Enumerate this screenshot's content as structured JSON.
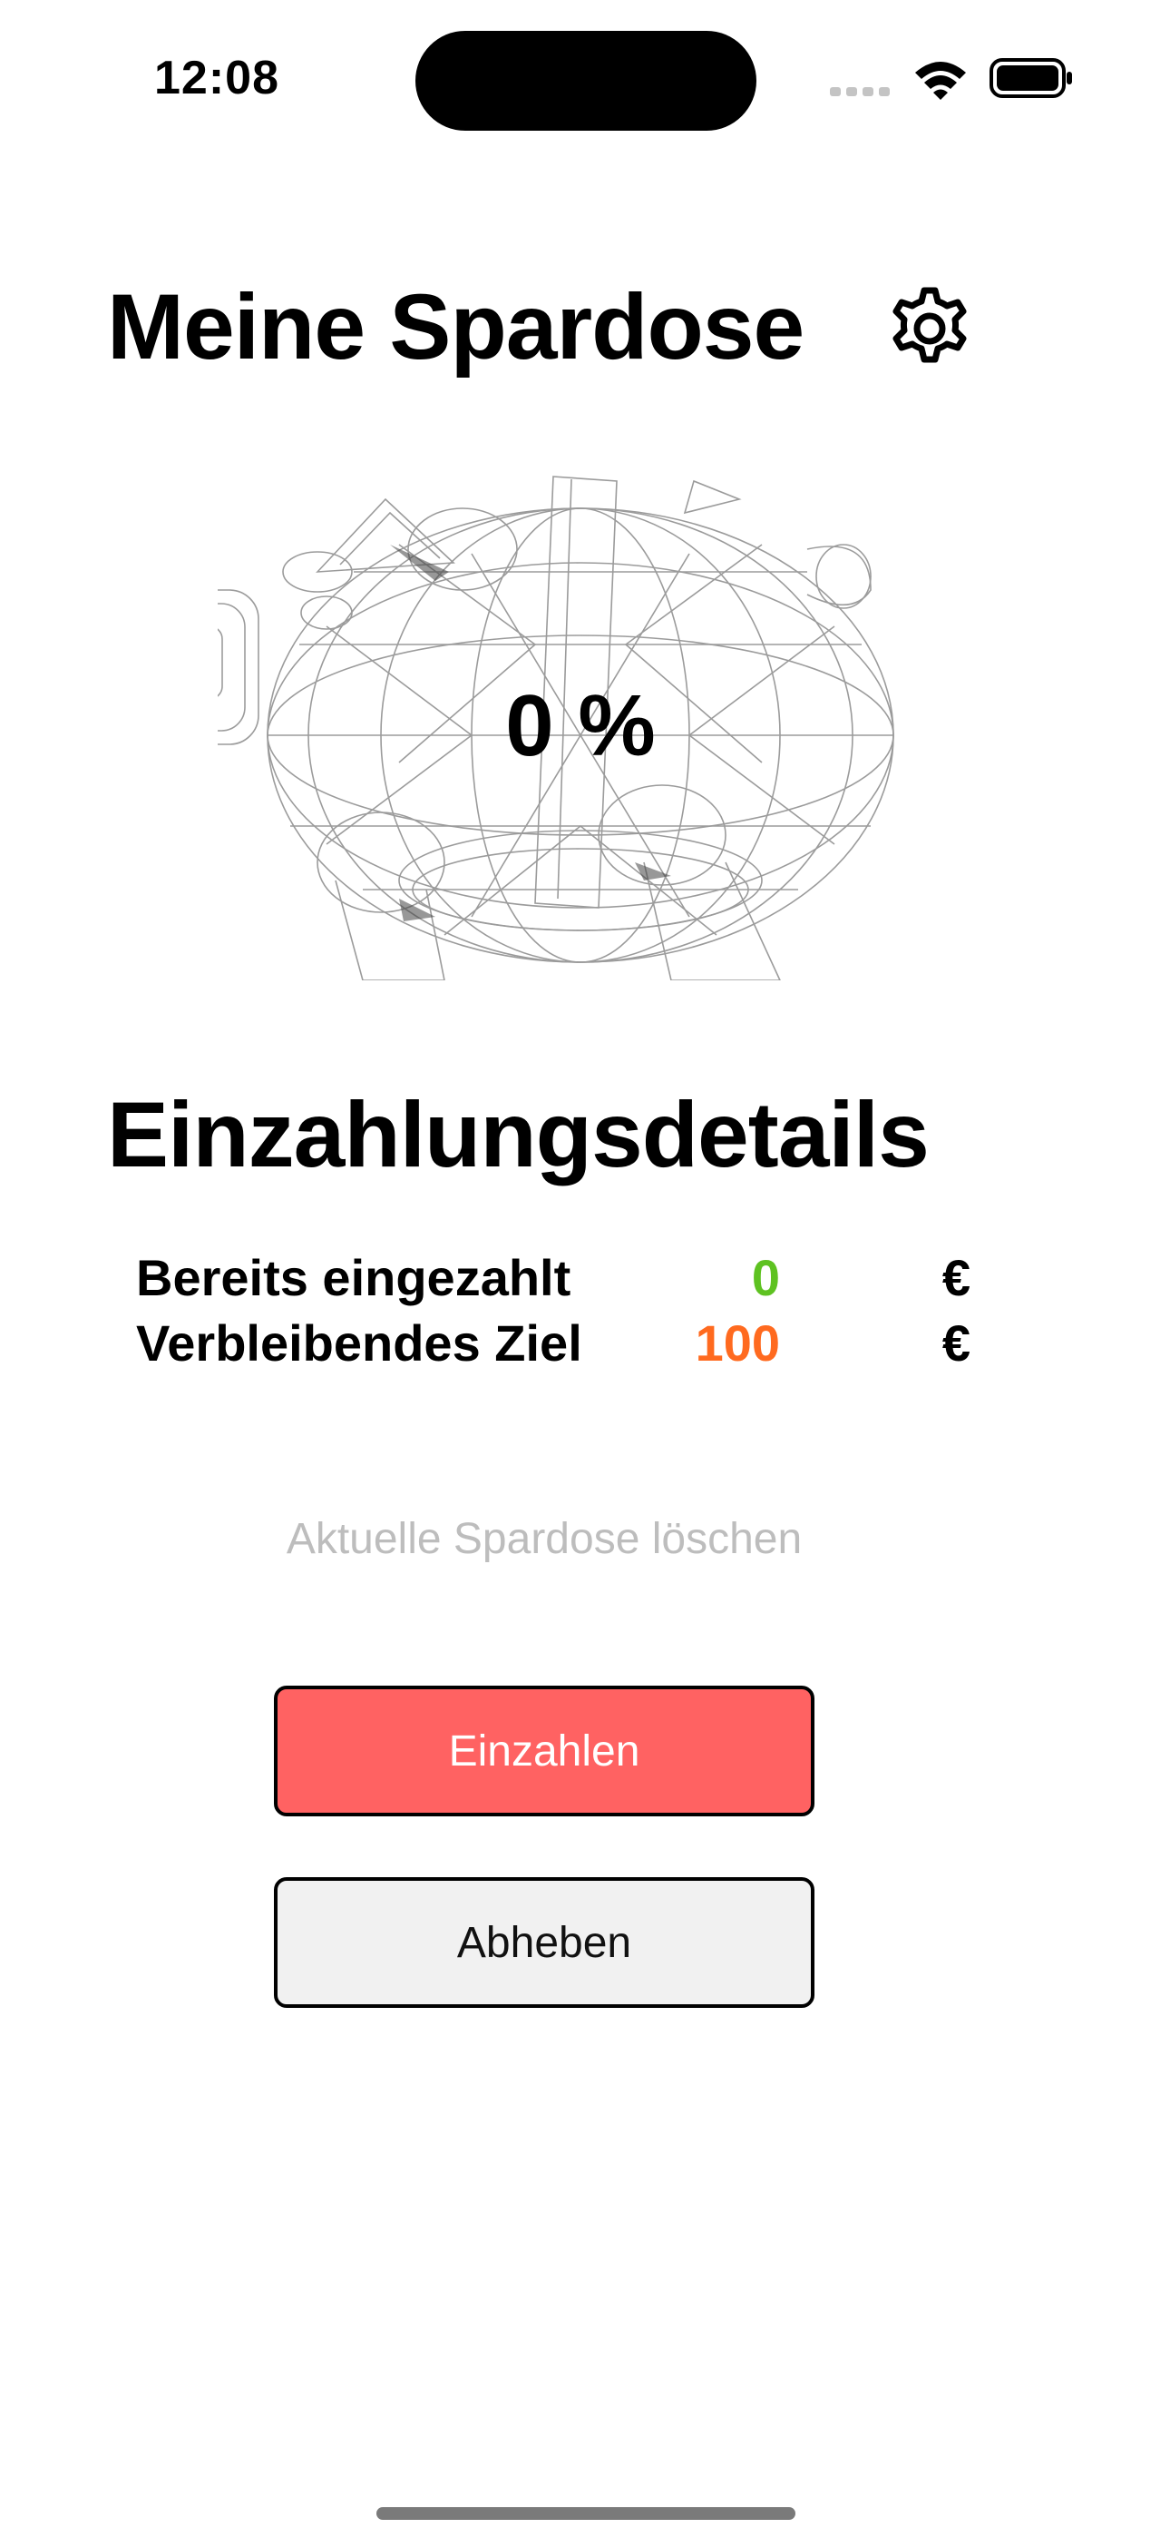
{
  "status_bar": {
    "time": "12:08",
    "icons": [
      "signal-icon",
      "wifi-icon",
      "battery-icon"
    ]
  },
  "header": {
    "title": "Meine Spardose",
    "settings_icon": "gear-icon"
  },
  "piggy": {
    "percent_text": "0 %"
  },
  "details": {
    "title": "Einzahlungsdetails",
    "rows": [
      {
        "label": "Bereits eingezahlt",
        "value": "0",
        "currency": "€",
        "color": "#5ec221"
      },
      {
        "label": "Verbleibendes Ziel",
        "value": "100",
        "currency": "€",
        "color": "#ff6a1f"
      }
    ]
  },
  "actions": {
    "delete_label": "Aktuelle Spardose löschen",
    "deposit_label": "Einzahlen",
    "withdraw_label": "Abheben"
  },
  "colors": {
    "deposit_button": "#ff6262",
    "withdraw_button": "#f1f1f1",
    "delete_text": "#bdbdbd"
  }
}
